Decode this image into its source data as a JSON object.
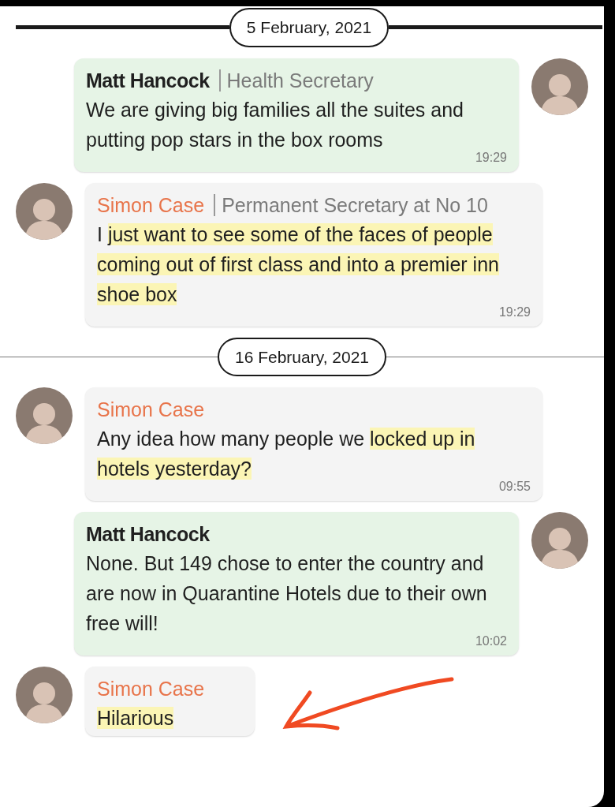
{
  "items": [
    {
      "kind": "date",
      "label": "5 February, 2021"
    },
    {
      "kind": "message",
      "outgoing": true,
      "sender": "Matt Hancock",
      "color": "#1f1f1f",
      "role": "Health Secretary",
      "segments": [
        {
          "text": "We are giving big families all the suites and putting pop stars in the box rooms",
          "highlighted": false
        }
      ],
      "time": "19:29"
    },
    {
      "kind": "message",
      "outgoing": false,
      "sender": "Simon Case",
      "color": "#e8744a",
      "role": "Permanent Secretary at No 10",
      "segments": [
        {
          "text": "I ",
          "highlighted": false
        },
        {
          "text": "just want to see some of the faces of people coming out of first class and into a premier inn shoe box",
          "highlighted": true
        }
      ],
      "time": "19:29"
    },
    {
      "kind": "date",
      "label": "16 February, 2021"
    },
    {
      "kind": "message",
      "outgoing": false,
      "sender": "Simon Case",
      "color": "#e8744a",
      "segments": [
        {
          "text": "Any idea how many people we ",
          "highlighted": false
        },
        {
          "text": "locked up in hotels yesterday?",
          "highlighted": true
        }
      ],
      "time": "09:55"
    },
    {
      "kind": "message",
      "outgoing": true,
      "sender": "Matt Hancock",
      "color": "#1f1f1f",
      "segments": [
        {
          "text": "None. But 149 chose to enter the country and are now in Quarantine Hotels due to their own free will!",
          "highlighted": false
        }
      ],
      "time": "10:02"
    },
    {
      "kind": "message",
      "outgoing": false,
      "sender": "Simon Case",
      "color": "#e8744a",
      "segments": [
        {
          "text": "Hilarious",
          "highlighted": true
        }
      ],
      "annotated": true
    }
  ]
}
